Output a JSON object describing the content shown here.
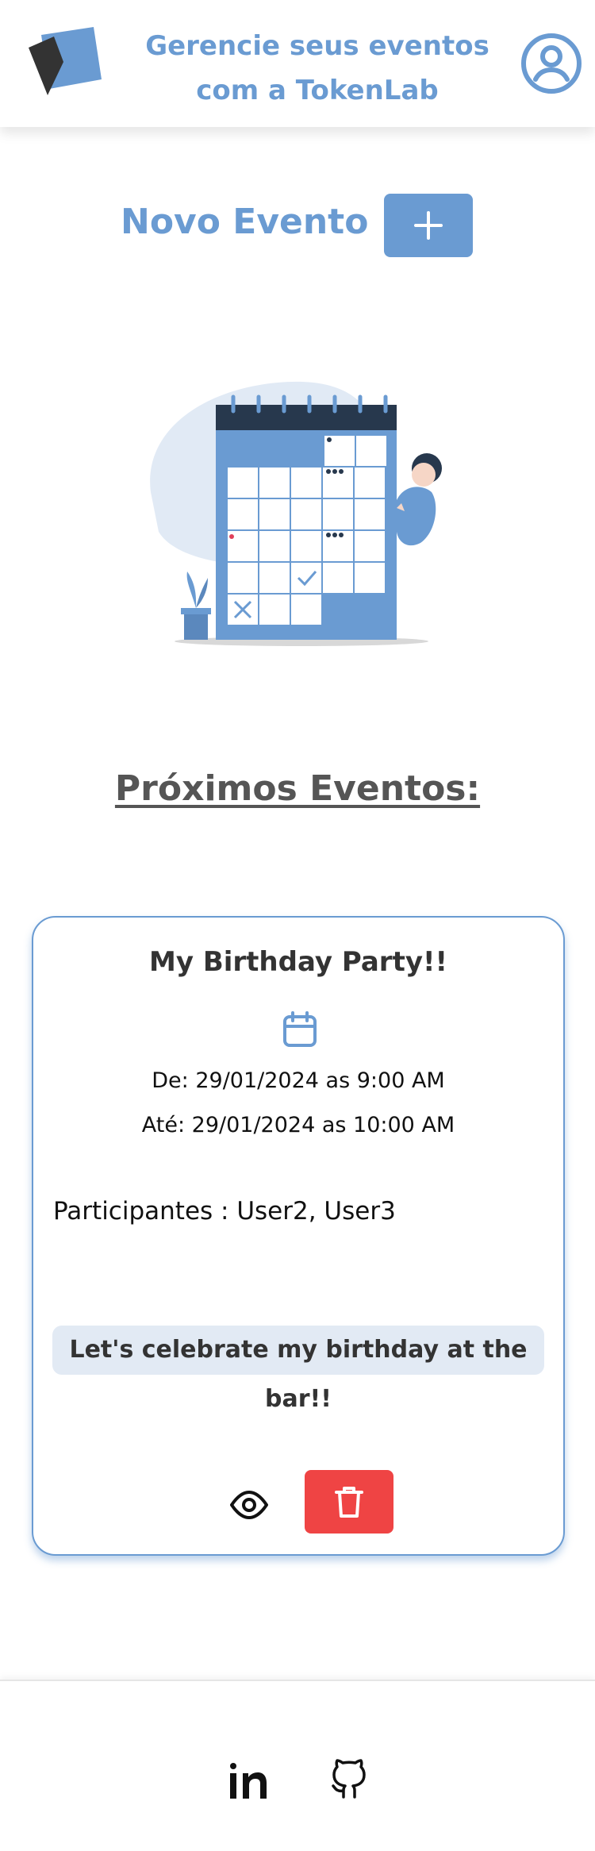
{
  "header": {
    "title_line1": "Gerencie seus eventos",
    "title_line2": "com a TokenLab",
    "logo_icon": "tokenlab-logo",
    "profile_icon": "user-circle-icon"
  },
  "new_event": {
    "label": "Novo Evento",
    "add_icon": "plus-icon"
  },
  "illustration": "calendar-person-illustration",
  "events_section": {
    "title": "Próximos Eventos:"
  },
  "events": [
    {
      "title": "My Birthday Party!!",
      "from": "De: 29/01/2024 as 9:00 AM",
      "to": "Até: 29/01/2024 as 10:00 AM",
      "participants_label": "Participantes :",
      "participants": "User2, User3",
      "description": "Let's celebrate my birthday at the bar!!",
      "view_icon": "eye-icon",
      "delete_icon": "trash-icon"
    }
  ],
  "footer": {
    "linkedin_icon": "linkedin-icon",
    "github_icon": "github-icon"
  },
  "colors": {
    "primary": "#6a9bd2",
    "danger": "#ef4444",
    "description_bg": "#e2eaf4",
    "section_title": "#555555"
  }
}
